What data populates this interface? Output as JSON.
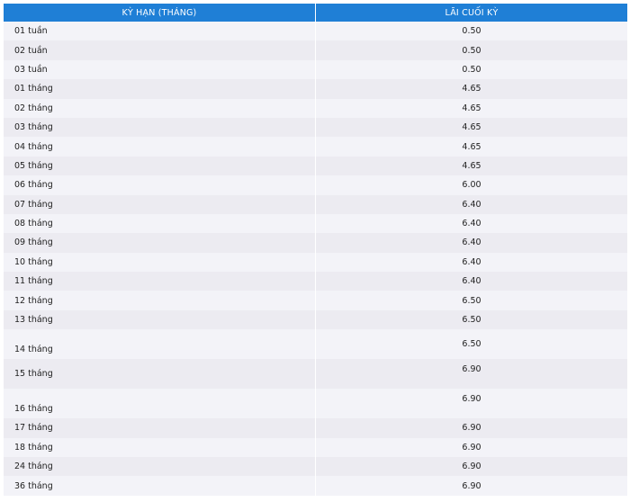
{
  "table": {
    "headers": [
      "KỲ HẠN (THÁNG)",
      "LÃI CUỐI KỲ"
    ],
    "rows": [
      {
        "term": "01 tuần",
        "rate": "0.50"
      },
      {
        "term": "02 tuần",
        "rate": "0.50"
      },
      {
        "term": "03 tuần",
        "rate": "0.50"
      },
      {
        "term": "01 tháng",
        "rate": "4.65"
      },
      {
        "term": "02 tháng",
        "rate": "4.65"
      },
      {
        "term": "03 tháng",
        "rate": "4.65"
      },
      {
        "term": "04 tháng",
        "rate": "4.65"
      },
      {
        "term": "05 tháng",
        "rate": "4.65"
      },
      {
        "term": "06 tháng",
        "rate": "6.00"
      },
      {
        "term": "07 tháng",
        "rate": "6.40"
      },
      {
        "term": "08 tháng",
        "rate": "6.40"
      },
      {
        "term": "09 tháng",
        "rate": "6.40"
      },
      {
        "term": "10 tháng",
        "rate": "6.40"
      },
      {
        "term": "11 tháng",
        "rate": "6.40"
      },
      {
        "term": "12 tháng",
        "rate": "6.50"
      },
      {
        "term": "13 tháng",
        "rate": "6.50"
      },
      {
        "term": "14 tháng",
        "rate": "6.50"
      },
      {
        "term": "15 tháng",
        "rate": "6.90"
      },
      {
        "term": "16 tháng",
        "rate": "6.90"
      },
      {
        "term": "17 tháng",
        "rate": "6.90"
      },
      {
        "term": "18 tháng",
        "rate": "6.90"
      },
      {
        "term": "24 tháng",
        "rate": "6.90"
      },
      {
        "term": "36 tháng",
        "rate": "6.90"
      }
    ]
  },
  "colors": {
    "header_bg": "#1f7fd6",
    "header_text": "#ffffff",
    "row_odd": "#f3f3f8",
    "row_even": "#ecebf1"
  }
}
